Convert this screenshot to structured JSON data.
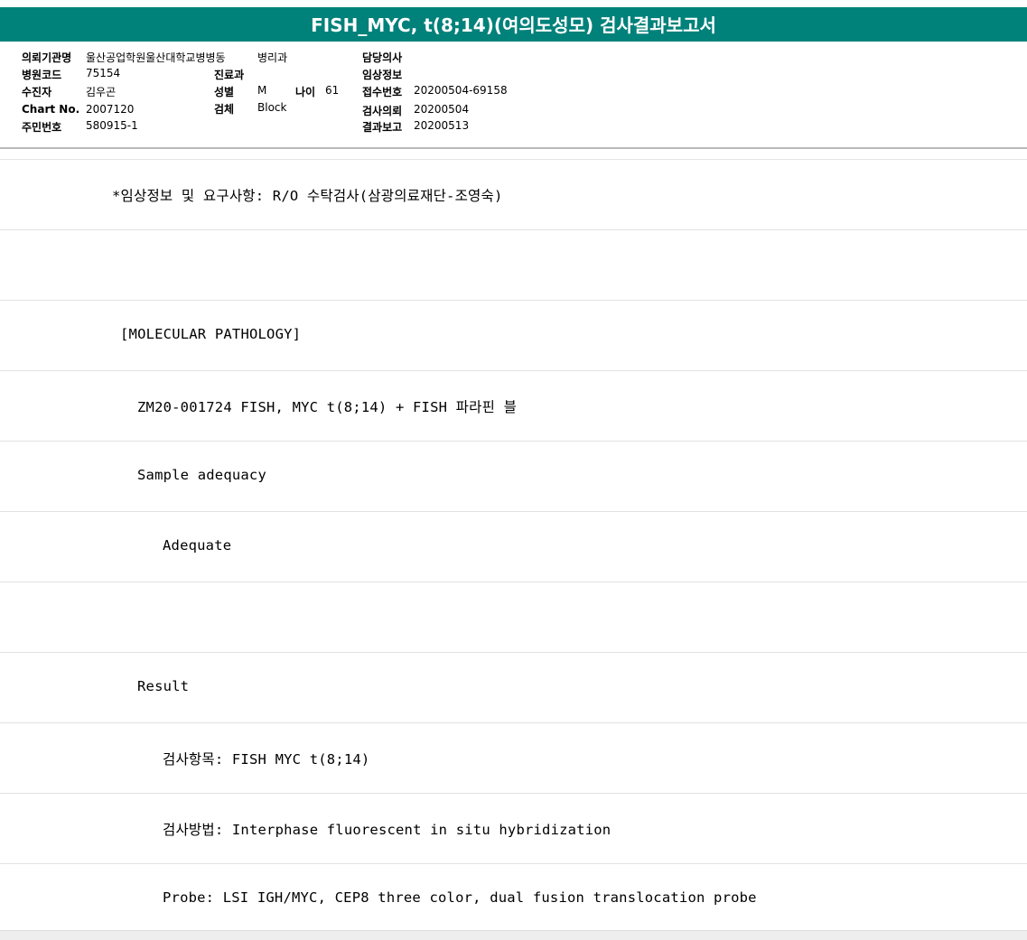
{
  "title": "FISH_MYC, t(8;14)(여의도성모) 검사결과보고서",
  "info": {
    "institution_label": "의뢰기관명",
    "institution_value": "울산공업학원울산대학교병병동",
    "ward_value": "병리과",
    "doctor_label": "담당의사",
    "hospital_code_label": "병원코드",
    "hospital_code_value": "75154",
    "department_label": "진료과",
    "clinical_info_label": "임상정보",
    "examinee_label": "수진자",
    "examinee_value": "김우곤",
    "sex_label": "성별",
    "sex_value": "M",
    "age_label": "나이",
    "age_value": "61",
    "receipt_no_label": "접수번호",
    "receipt_no_value": "20200504-69158",
    "chart_no_label": "Chart No.",
    "chart_no_value": "2007120",
    "specimen_label": "검체",
    "specimen_value": "Block",
    "request_label": "검사의뢰",
    "request_value": "20200504",
    "resident_no_label": "주민번호",
    "resident_no_value": "580915-1",
    "report_label": "결과보고",
    "report_value": "20200513"
  },
  "rows": [
    "*임상정보 및 요구사항: R/O 수탁검사(삼광의료재단-조영숙)",
    "",
    "[MOLECULAR PATHOLOGY]",
    "ZM20-001724     FISH, MYC t(8;14) + FISH 파라핀 블",
    "Sample adequacy",
    "Adequate",
    "",
    "Result",
    "검사항목: FISH MYC t(8;14)",
    "검사방법: Interphase fluorescent in situ hybridization",
    "Probe: LSI IGH/MYC, CEP8 three color, dual fusion translocation probe"
  ]
}
